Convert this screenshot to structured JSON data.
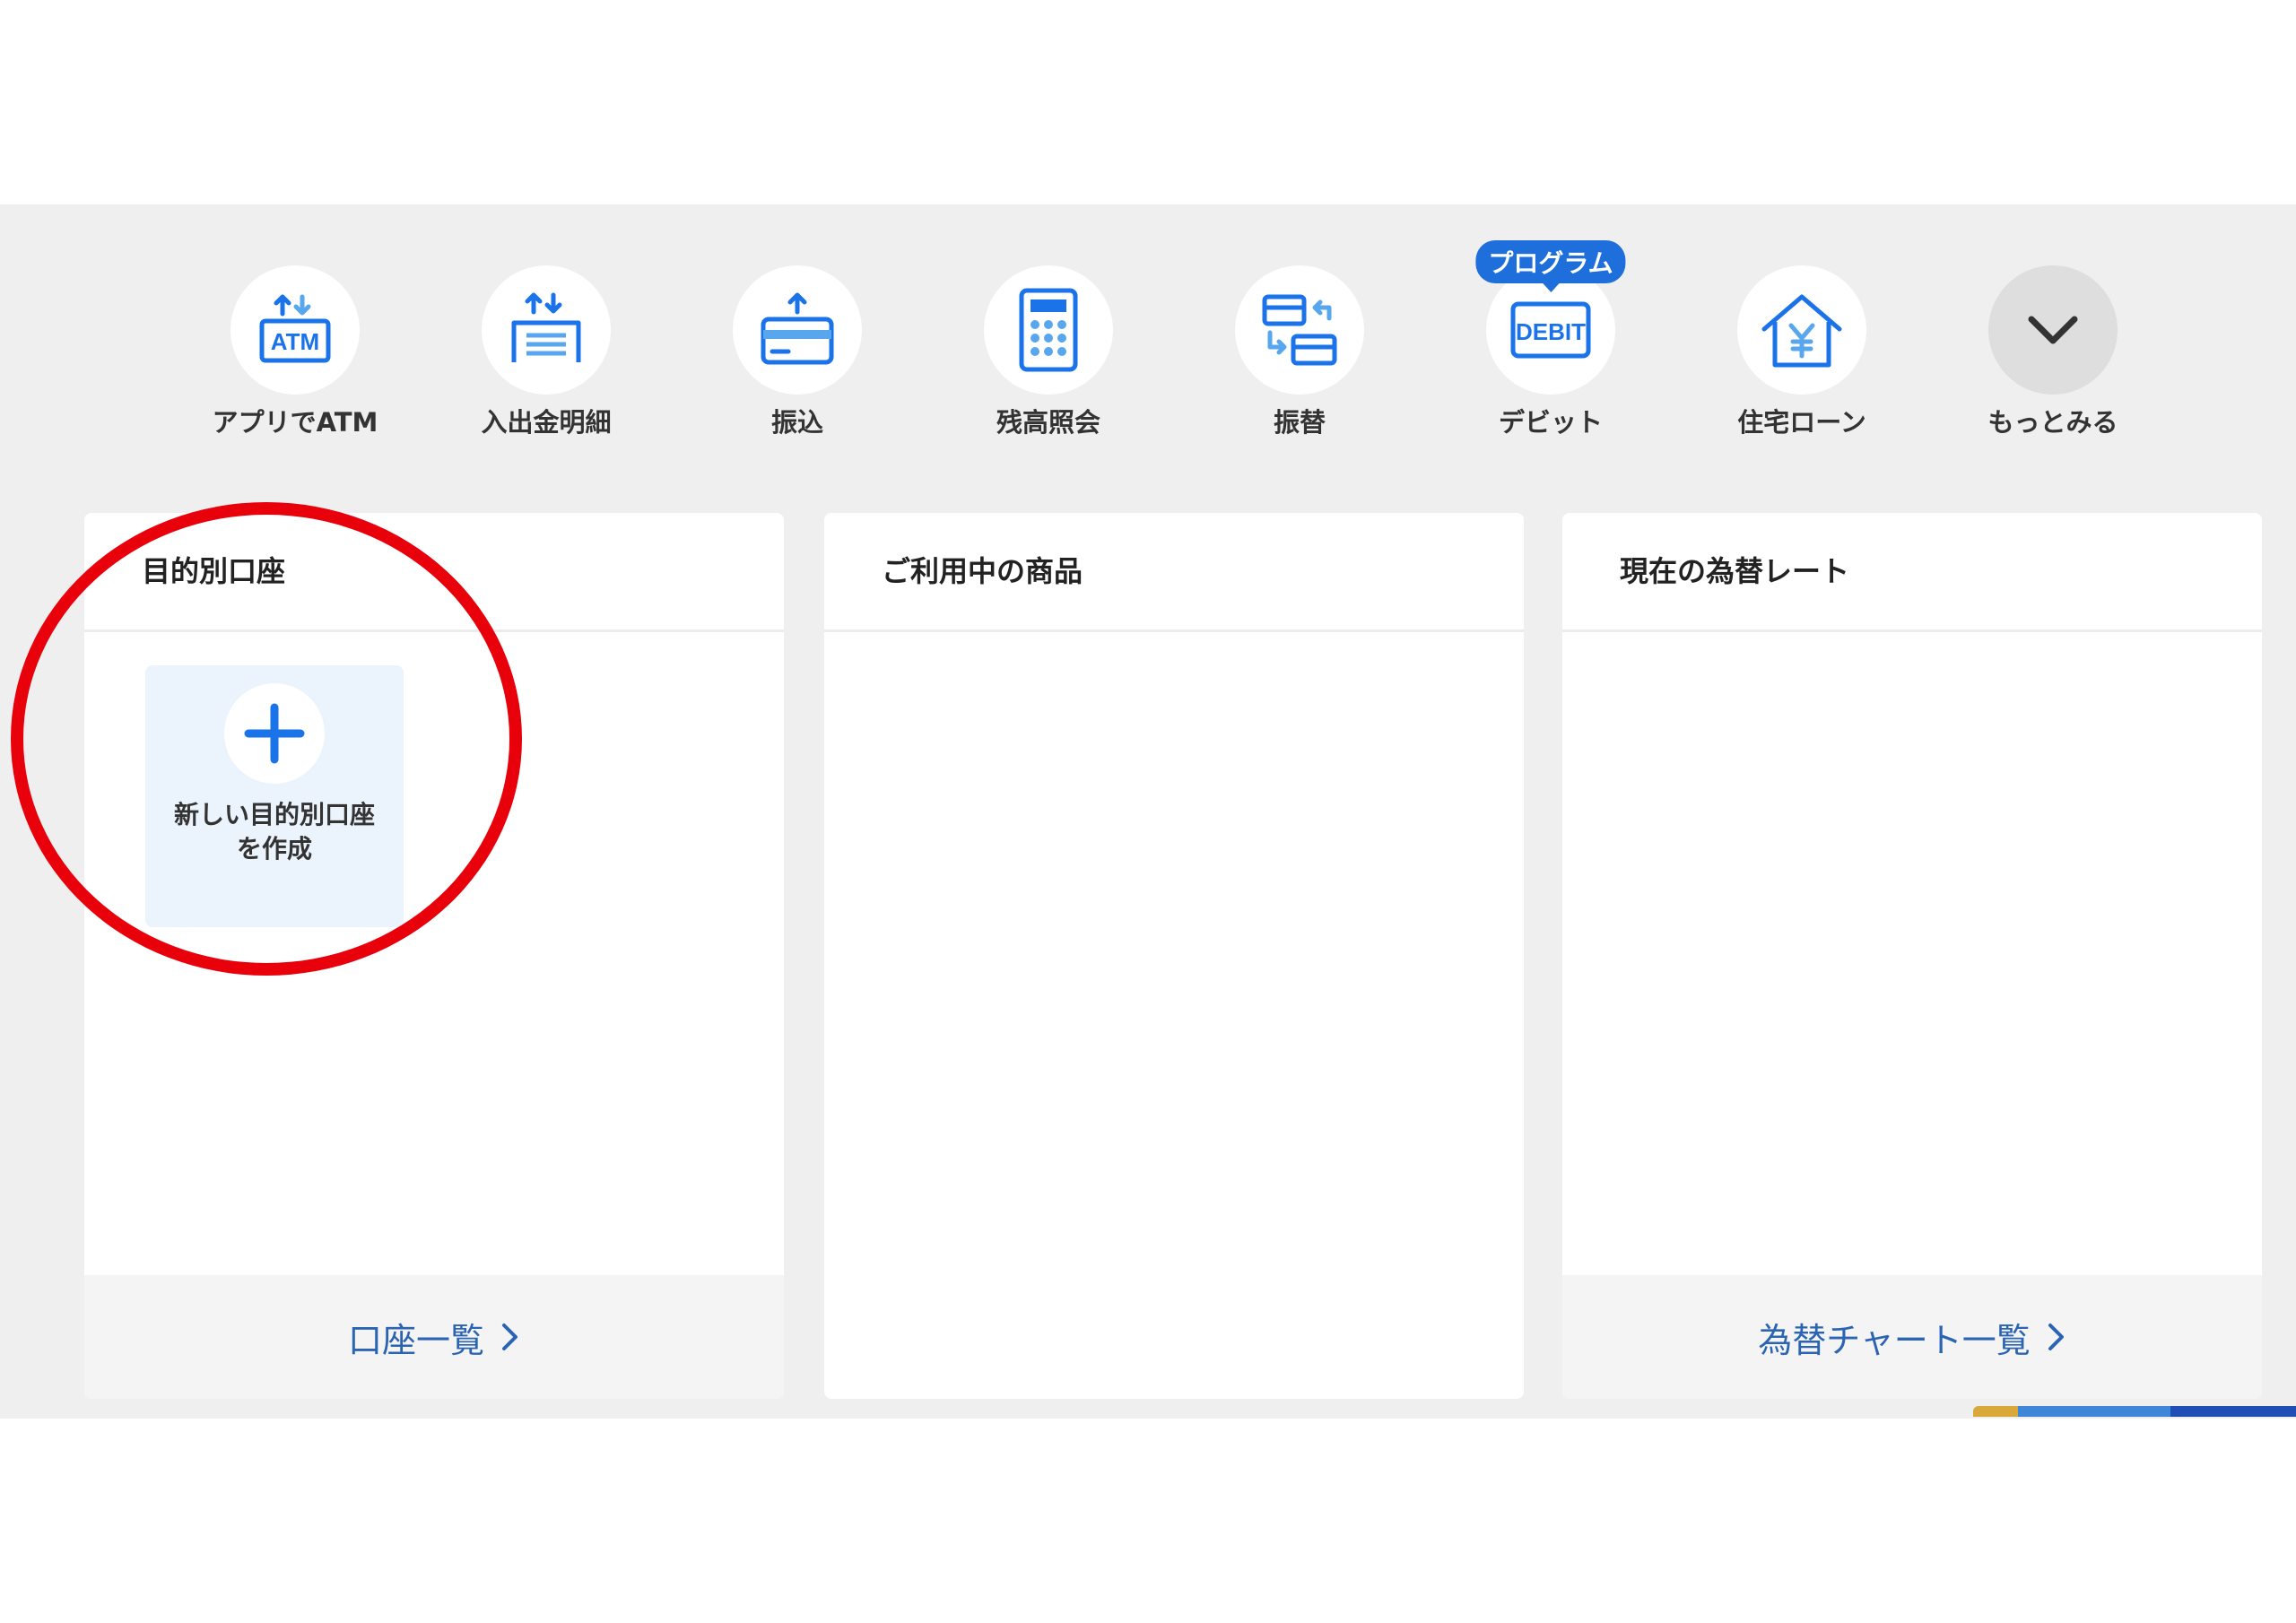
{
  "quick_actions": [
    {
      "label": "アプリでATM",
      "icon": "atm-icon"
    },
    {
      "label": "入出金明細",
      "icon": "statement-icon"
    },
    {
      "label": "振込",
      "icon": "transfer-card-icon"
    },
    {
      "label": "残高照会",
      "icon": "calculator-icon"
    },
    {
      "label": "振替",
      "icon": "account-transfer-icon"
    },
    {
      "label": "デビット",
      "icon": "debit-icon",
      "badge": "プログラム",
      "icon_text": "DEBIT"
    },
    {
      "label": "住宅ローン",
      "icon": "house-yen-icon"
    },
    {
      "label": "もっとみる",
      "icon": "chevron-down-icon"
    }
  ],
  "atm_icon_text": "ATM",
  "cards": {
    "goal_accounts": {
      "title": "目的別口座",
      "new_tile_label": "新しい目的別口座を作成",
      "footer_link": "口座一覧"
    },
    "products": {
      "title": "ご利用中の商品"
    },
    "exchange_rates": {
      "title": "現在の為替レート",
      "footer_link": "為替チャート一覧"
    }
  },
  "colors": {
    "accent": "#1e6fdc",
    "icon_blue": "#1a73e8",
    "icon_light": "#58a7ee",
    "link": "#2c64b4",
    "annotation": "#e8000b",
    "band": "#efefef"
  }
}
